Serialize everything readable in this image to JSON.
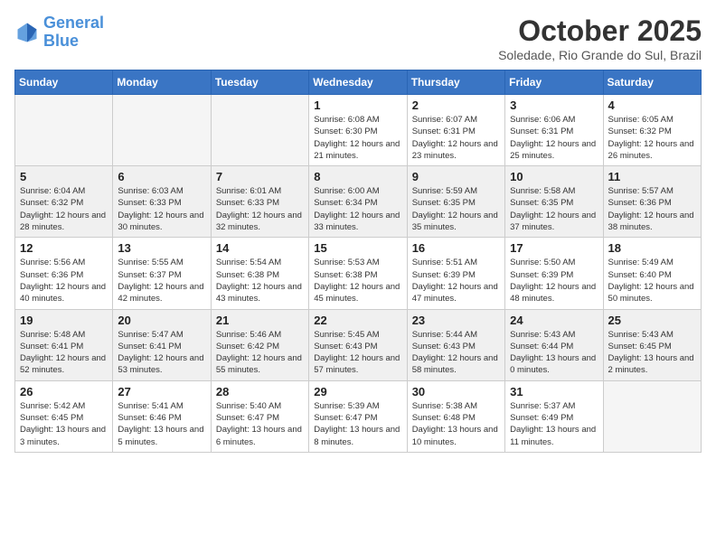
{
  "header": {
    "logo_line1": "General",
    "logo_line2": "Blue",
    "month": "October 2025",
    "location": "Soledade, Rio Grande do Sul, Brazil"
  },
  "days_of_week": [
    "Sunday",
    "Monday",
    "Tuesday",
    "Wednesday",
    "Thursday",
    "Friday",
    "Saturday"
  ],
  "weeks": [
    [
      {
        "day": "",
        "empty": true
      },
      {
        "day": "",
        "empty": true
      },
      {
        "day": "",
        "empty": true
      },
      {
        "day": "1",
        "sunrise": "6:08 AM",
        "sunset": "6:30 PM",
        "daylight": "12 hours and 21 minutes."
      },
      {
        "day": "2",
        "sunrise": "6:07 AM",
        "sunset": "6:31 PM",
        "daylight": "12 hours and 23 minutes."
      },
      {
        "day": "3",
        "sunrise": "6:06 AM",
        "sunset": "6:31 PM",
        "daylight": "12 hours and 25 minutes."
      },
      {
        "day": "4",
        "sunrise": "6:05 AM",
        "sunset": "6:32 PM",
        "daylight": "12 hours and 26 minutes."
      }
    ],
    [
      {
        "day": "5",
        "sunrise": "6:04 AM",
        "sunset": "6:32 PM",
        "daylight": "12 hours and 28 minutes."
      },
      {
        "day": "6",
        "sunrise": "6:03 AM",
        "sunset": "6:33 PM",
        "daylight": "12 hours and 30 minutes."
      },
      {
        "day": "7",
        "sunrise": "6:01 AM",
        "sunset": "6:33 PM",
        "daylight": "12 hours and 32 minutes."
      },
      {
        "day": "8",
        "sunrise": "6:00 AM",
        "sunset": "6:34 PM",
        "daylight": "12 hours and 33 minutes."
      },
      {
        "day": "9",
        "sunrise": "5:59 AM",
        "sunset": "6:35 PM",
        "daylight": "12 hours and 35 minutes."
      },
      {
        "day": "10",
        "sunrise": "5:58 AM",
        "sunset": "6:35 PM",
        "daylight": "12 hours and 37 minutes."
      },
      {
        "day": "11",
        "sunrise": "5:57 AM",
        "sunset": "6:36 PM",
        "daylight": "12 hours and 38 minutes."
      }
    ],
    [
      {
        "day": "12",
        "sunrise": "5:56 AM",
        "sunset": "6:36 PM",
        "daylight": "12 hours and 40 minutes."
      },
      {
        "day": "13",
        "sunrise": "5:55 AM",
        "sunset": "6:37 PM",
        "daylight": "12 hours and 42 minutes."
      },
      {
        "day": "14",
        "sunrise": "5:54 AM",
        "sunset": "6:38 PM",
        "daylight": "12 hours and 43 minutes."
      },
      {
        "day": "15",
        "sunrise": "5:53 AM",
        "sunset": "6:38 PM",
        "daylight": "12 hours and 45 minutes."
      },
      {
        "day": "16",
        "sunrise": "5:51 AM",
        "sunset": "6:39 PM",
        "daylight": "12 hours and 47 minutes."
      },
      {
        "day": "17",
        "sunrise": "5:50 AM",
        "sunset": "6:39 PM",
        "daylight": "12 hours and 48 minutes."
      },
      {
        "day": "18",
        "sunrise": "5:49 AM",
        "sunset": "6:40 PM",
        "daylight": "12 hours and 50 minutes."
      }
    ],
    [
      {
        "day": "19",
        "sunrise": "5:48 AM",
        "sunset": "6:41 PM",
        "daylight": "12 hours and 52 minutes."
      },
      {
        "day": "20",
        "sunrise": "5:47 AM",
        "sunset": "6:41 PM",
        "daylight": "12 hours and 53 minutes."
      },
      {
        "day": "21",
        "sunrise": "5:46 AM",
        "sunset": "6:42 PM",
        "daylight": "12 hours and 55 minutes."
      },
      {
        "day": "22",
        "sunrise": "5:45 AM",
        "sunset": "6:43 PM",
        "daylight": "12 hours and 57 minutes."
      },
      {
        "day": "23",
        "sunrise": "5:44 AM",
        "sunset": "6:43 PM",
        "daylight": "12 hours and 58 minutes."
      },
      {
        "day": "24",
        "sunrise": "5:43 AM",
        "sunset": "6:44 PM",
        "daylight": "13 hours and 0 minutes."
      },
      {
        "day": "25",
        "sunrise": "5:43 AM",
        "sunset": "6:45 PM",
        "daylight": "13 hours and 2 minutes."
      }
    ],
    [
      {
        "day": "26",
        "sunrise": "5:42 AM",
        "sunset": "6:45 PM",
        "daylight": "13 hours and 3 minutes."
      },
      {
        "day": "27",
        "sunrise": "5:41 AM",
        "sunset": "6:46 PM",
        "daylight": "13 hours and 5 minutes."
      },
      {
        "day": "28",
        "sunrise": "5:40 AM",
        "sunset": "6:47 PM",
        "daylight": "13 hours and 6 minutes."
      },
      {
        "day": "29",
        "sunrise": "5:39 AM",
        "sunset": "6:47 PM",
        "daylight": "13 hours and 8 minutes."
      },
      {
        "day": "30",
        "sunrise": "5:38 AM",
        "sunset": "6:48 PM",
        "daylight": "13 hours and 10 minutes."
      },
      {
        "day": "31",
        "sunrise": "5:37 AM",
        "sunset": "6:49 PM",
        "daylight": "13 hours and 11 minutes."
      },
      {
        "day": "",
        "empty": true
      }
    ]
  ]
}
